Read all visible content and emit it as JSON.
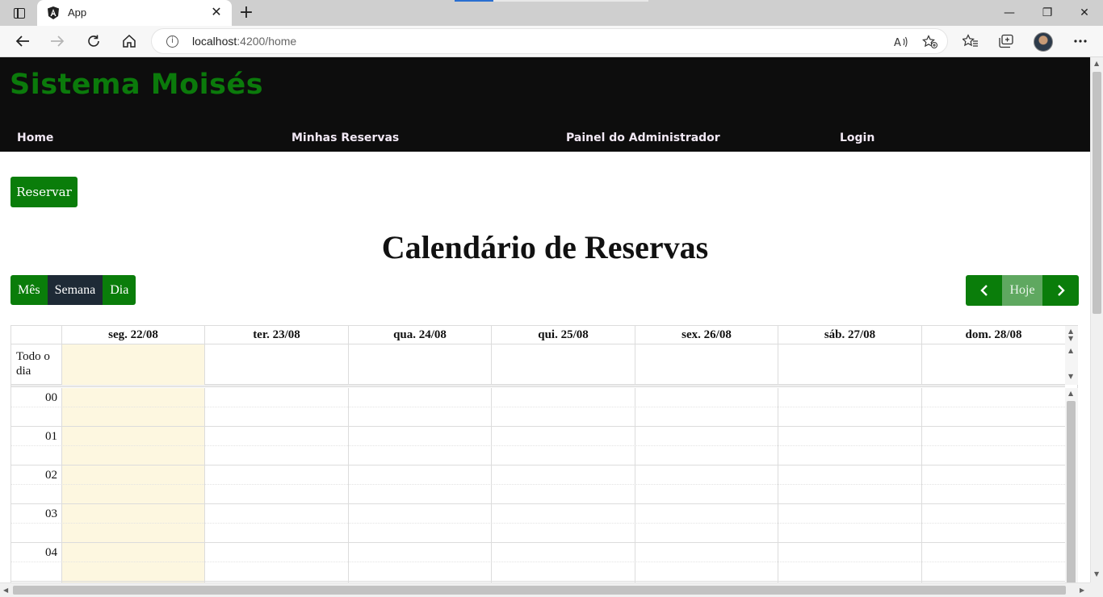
{
  "browser": {
    "tab_title": "App",
    "url_host": "localhost",
    "url_path": ":4200/home"
  },
  "app": {
    "brand": "Sistema Moisés",
    "nav": [
      "Home",
      "Minhas Reservas",
      "Painel do Administrador",
      "Login"
    ],
    "reserve_button": "Reservar",
    "calendar_title": "Calendário de Reservas",
    "views": [
      "Mês",
      "Semana",
      "Dia"
    ],
    "active_view": "Semana",
    "today_label": "Hoje",
    "all_day_label": "Todo o dia",
    "days": [
      "seg. 22/08",
      "ter. 23/08",
      "qua. 24/08",
      "qui. 25/08",
      "sex. 26/08",
      "sáb. 27/08",
      "dom. 28/08"
    ],
    "hours": [
      "00",
      "01",
      "02",
      "03",
      "04"
    ],
    "colors": {
      "brand_green": "#0b7a0b",
      "header_bg": "#0d0d0d",
      "active_view": "#1e2a36",
      "today_highlight": "#fdf7e0"
    }
  }
}
